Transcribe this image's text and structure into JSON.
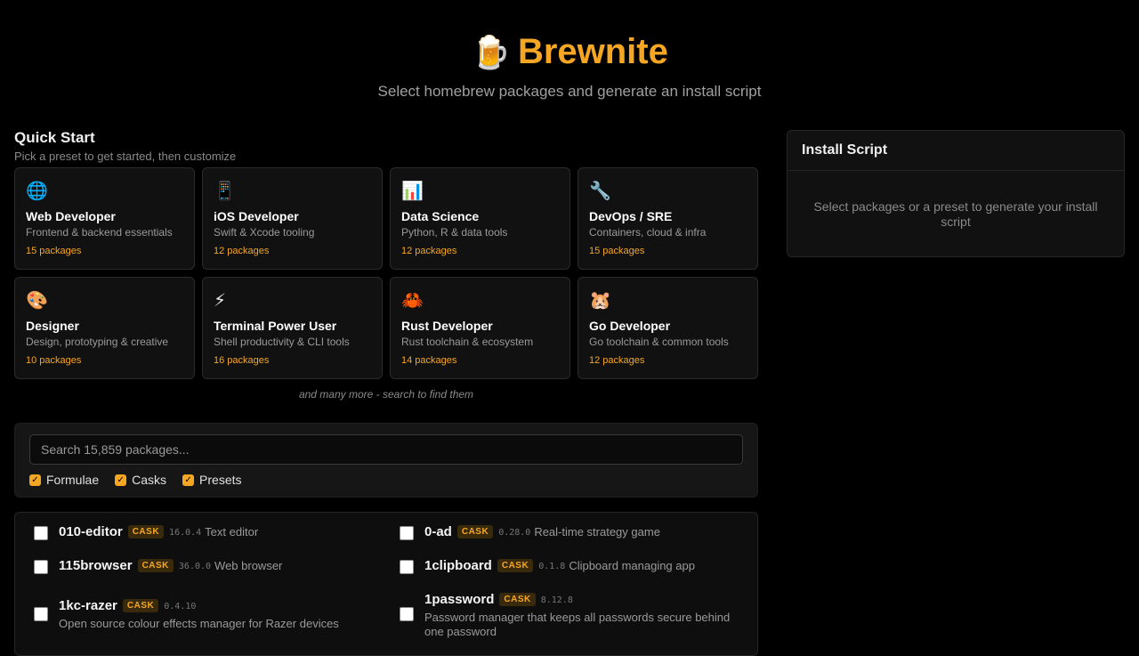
{
  "header": {
    "emoji": "🍺",
    "title": "Brewnite",
    "subtitle": "Select homebrew packages and generate an install script"
  },
  "quick_start": {
    "title": "Quick Start",
    "subtitle": "Pick a preset to get started, then customize",
    "presets": [
      {
        "icon": "🌐",
        "name": "Web Developer",
        "desc": "Frontend & backend essentials",
        "count": "15 packages"
      },
      {
        "icon": "📱",
        "name": "iOS Developer",
        "desc": "Swift & Xcode tooling",
        "count": "12 packages"
      },
      {
        "icon": "📊",
        "name": "Data Science",
        "desc": "Python, R & data tools",
        "count": "12 packages"
      },
      {
        "icon": "🔧",
        "name": "DevOps / SRE",
        "desc": "Containers, cloud & infra",
        "count": "15 packages"
      },
      {
        "icon": "🎨",
        "name": "Designer",
        "desc": "Design, prototyping & creative",
        "count": "10 packages"
      },
      {
        "icon": "⚡",
        "name": "Terminal Power User",
        "desc": "Shell productivity & CLI tools",
        "count": "16 packages"
      },
      {
        "icon": "🦀",
        "name": "Rust Developer",
        "desc": "Rust toolchain & ecosystem",
        "count": "14 packages"
      },
      {
        "icon": "🐹",
        "name": "Go Developer",
        "desc": "Go toolchain & common tools",
        "count": "12 packages"
      }
    ],
    "more": "and many more - search to find them"
  },
  "search": {
    "placeholder": "Search 15,859 packages...",
    "filters": [
      "Formulae",
      "Casks",
      "Presets"
    ]
  },
  "packages": [
    {
      "name": "010-editor",
      "type": "CASK",
      "version": "16.0.4",
      "desc": "Text editor"
    },
    {
      "name": "0-ad",
      "type": "CASK",
      "version": "0.28.0",
      "desc": "Real-time strategy game"
    },
    {
      "name": "115browser",
      "type": "CASK",
      "version": "36.0.0",
      "desc": "Web browser"
    },
    {
      "name": "1clipboard",
      "type": "CASK",
      "version": "0.1.8",
      "desc": "Clipboard managing app"
    },
    {
      "name": "1kc-razer",
      "type": "CASK",
      "version": "0.4.10",
      "desc": "Open source colour effects manager for Razer devices"
    },
    {
      "name": "1password",
      "type": "CASK",
      "version": "8.12.8",
      "desc": "Password manager that keeps all passwords secure behind one password"
    }
  ],
  "install_script": {
    "title": "Install Script",
    "empty": "Select packages or a preset to generate your install script"
  }
}
